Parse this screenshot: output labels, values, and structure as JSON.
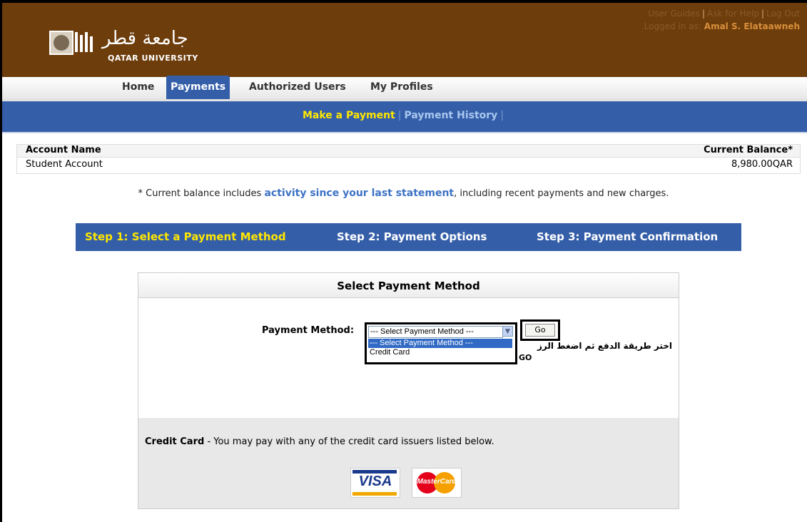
{
  "header": {
    "logo_arabic": "جامعة قطر",
    "logo_english": "QATAR UNIVERSITY",
    "links": [
      "User Guides",
      "Ask for Help",
      "Log Out"
    ],
    "logged_in_prefix": "Logged in as:",
    "user_name": "Amal S. Elataawneh"
  },
  "tabs": [
    {
      "label": "Home",
      "active": false
    },
    {
      "label": "Payments",
      "active": true
    },
    {
      "label": "Authorized Users",
      "active": false
    },
    {
      "label": "My Profiles",
      "active": false
    }
  ],
  "subnav": {
    "make_payment": "Make a Payment",
    "payment_history": "Payment History"
  },
  "account_table": {
    "headers": {
      "name": "Account Name",
      "balance": "Current Balance*"
    },
    "rows": [
      {
        "name": "Student Account",
        "balance": "8,980.00QAR"
      }
    ]
  },
  "note": {
    "prefix": "* Current balance includes ",
    "link": "activity since your last statement",
    "suffix": ", including recent payments and new charges."
  },
  "steps": [
    {
      "label": "Step 1: Select a Payment Method",
      "active": true
    },
    {
      "label": "Step 2: Payment Options",
      "active": false
    },
    {
      "label": "Step 3: Payment Confirmation",
      "active": false
    }
  ],
  "panel": {
    "title": "Select Payment Method",
    "field_label": "Payment Method:",
    "selected_value": "--- Select Payment Method ---",
    "options": [
      "--- Select Payment Method ---",
      "Credit Card"
    ],
    "go_label": "Go",
    "instruction_arabic": "اختر طريقة الدفع ثم اضغط الرز",
    "instruction_go": "GO",
    "cc_title": "Credit Card",
    "cc_text": " - You may pay with any of the credit card issuers listed below.",
    "visa": "VISA",
    "mastercard": "MasterCard"
  },
  "colors": {
    "header_bg": "#6d3d0c",
    "nav_blue": "#345ea8",
    "active_yellow": "#ffe700"
  }
}
